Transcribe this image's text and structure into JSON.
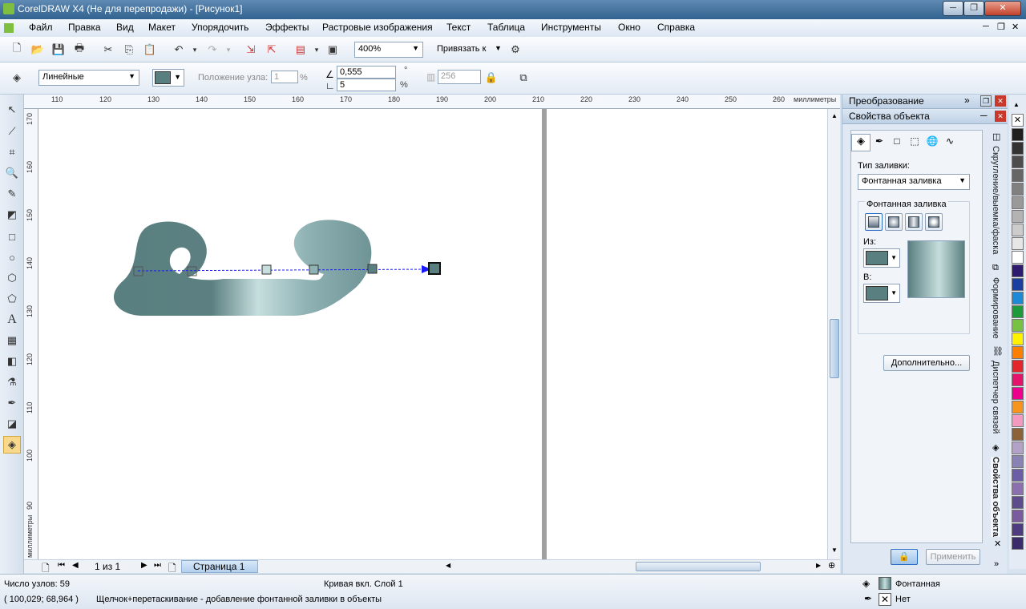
{
  "window": {
    "title": "CorelDRAW X4 (Не для перепродажи) - [Рисунок1]"
  },
  "menu": [
    "Файл",
    "Правка",
    "Вид",
    "Макет",
    "Упорядочить",
    "Эффекты",
    "Растровые изображения",
    "Текст",
    "Таблица",
    "Инструменты",
    "Окно",
    "Справка"
  ],
  "toolbar": {
    "zoom": "400%",
    "snap_label": "Привязать к"
  },
  "propbar": {
    "fill_mode": "Линейные",
    "node_pos_label": "Положение узла:",
    "node_pos_value": "1",
    "node_pos_unit": "%",
    "angle_value": "0,555",
    "angle_unit": "°",
    "edge_value": "5",
    "edge_unit": "%",
    "steps_value": "256"
  },
  "ruler": {
    "top_ticks": [
      "110",
      "120",
      "130",
      "140",
      "150",
      "160",
      "170",
      "180",
      "190",
      "200",
      "210",
      "220",
      "230",
      "240",
      "250",
      "260"
    ],
    "top_unit": "миллиметры",
    "left_ticks": [
      "170",
      "160",
      "150",
      "140",
      "130",
      "120",
      "110",
      "100",
      "90"
    ],
    "left_unit": "миллиметры"
  },
  "page_nav": {
    "counter": "1 из 1",
    "page_tab": "Страница 1"
  },
  "docker": {
    "transform_title": "Преобразование",
    "props_title": "Свойства объекта",
    "fill_type_label": "Тип заливки:",
    "fill_type_value": "Фонтанная заливка",
    "group_label": "Фонтанная заливка",
    "from_label": "Из:",
    "to_label": "В:",
    "advanced_button": "Дополнительно...",
    "apply_button": "Применить"
  },
  "side_tabs": [
    "Скругление/выемка/фаска",
    "Формирование",
    "Диспетчер связей",
    "Свойства объекта"
  ],
  "status": {
    "nodes": "Число узлов: 59",
    "object_info": "Кривая вкл. Слой 1",
    "coords": "( 100,029; 68,964 )",
    "hint": "Щелчок+перетаскивание - добавление фонтанной заливки в объекты",
    "fill_text": "Фонтанная",
    "outline_text": "Нет"
  },
  "colors": {
    "from": "#5a7f80",
    "to": "#5a7f80",
    "gradient_mid": "#c6dedd"
  },
  "palette": [
    "#1f1f1f",
    "#333333",
    "#4d4d4d",
    "#666666",
    "#808080",
    "#999999",
    "#b3b3b3",
    "#cccccc",
    "#e6e6e6",
    "#ffffff",
    "#2e1a6e",
    "#1b3fa0",
    "#1e8ad6",
    "#1f9a3b",
    "#79c142",
    "#fff200",
    "#ff7f00",
    "#e3262b",
    "#e4136b",
    "#ec008c",
    "#f7941d",
    "#f49ac1",
    "#8c6239",
    "#b3a2c7",
    "#8882b5",
    "#6c5ea6",
    "#8b6fae",
    "#5d4b8c",
    "#7a5c9e",
    "#4e3b80",
    "#3a2c6a"
  ]
}
